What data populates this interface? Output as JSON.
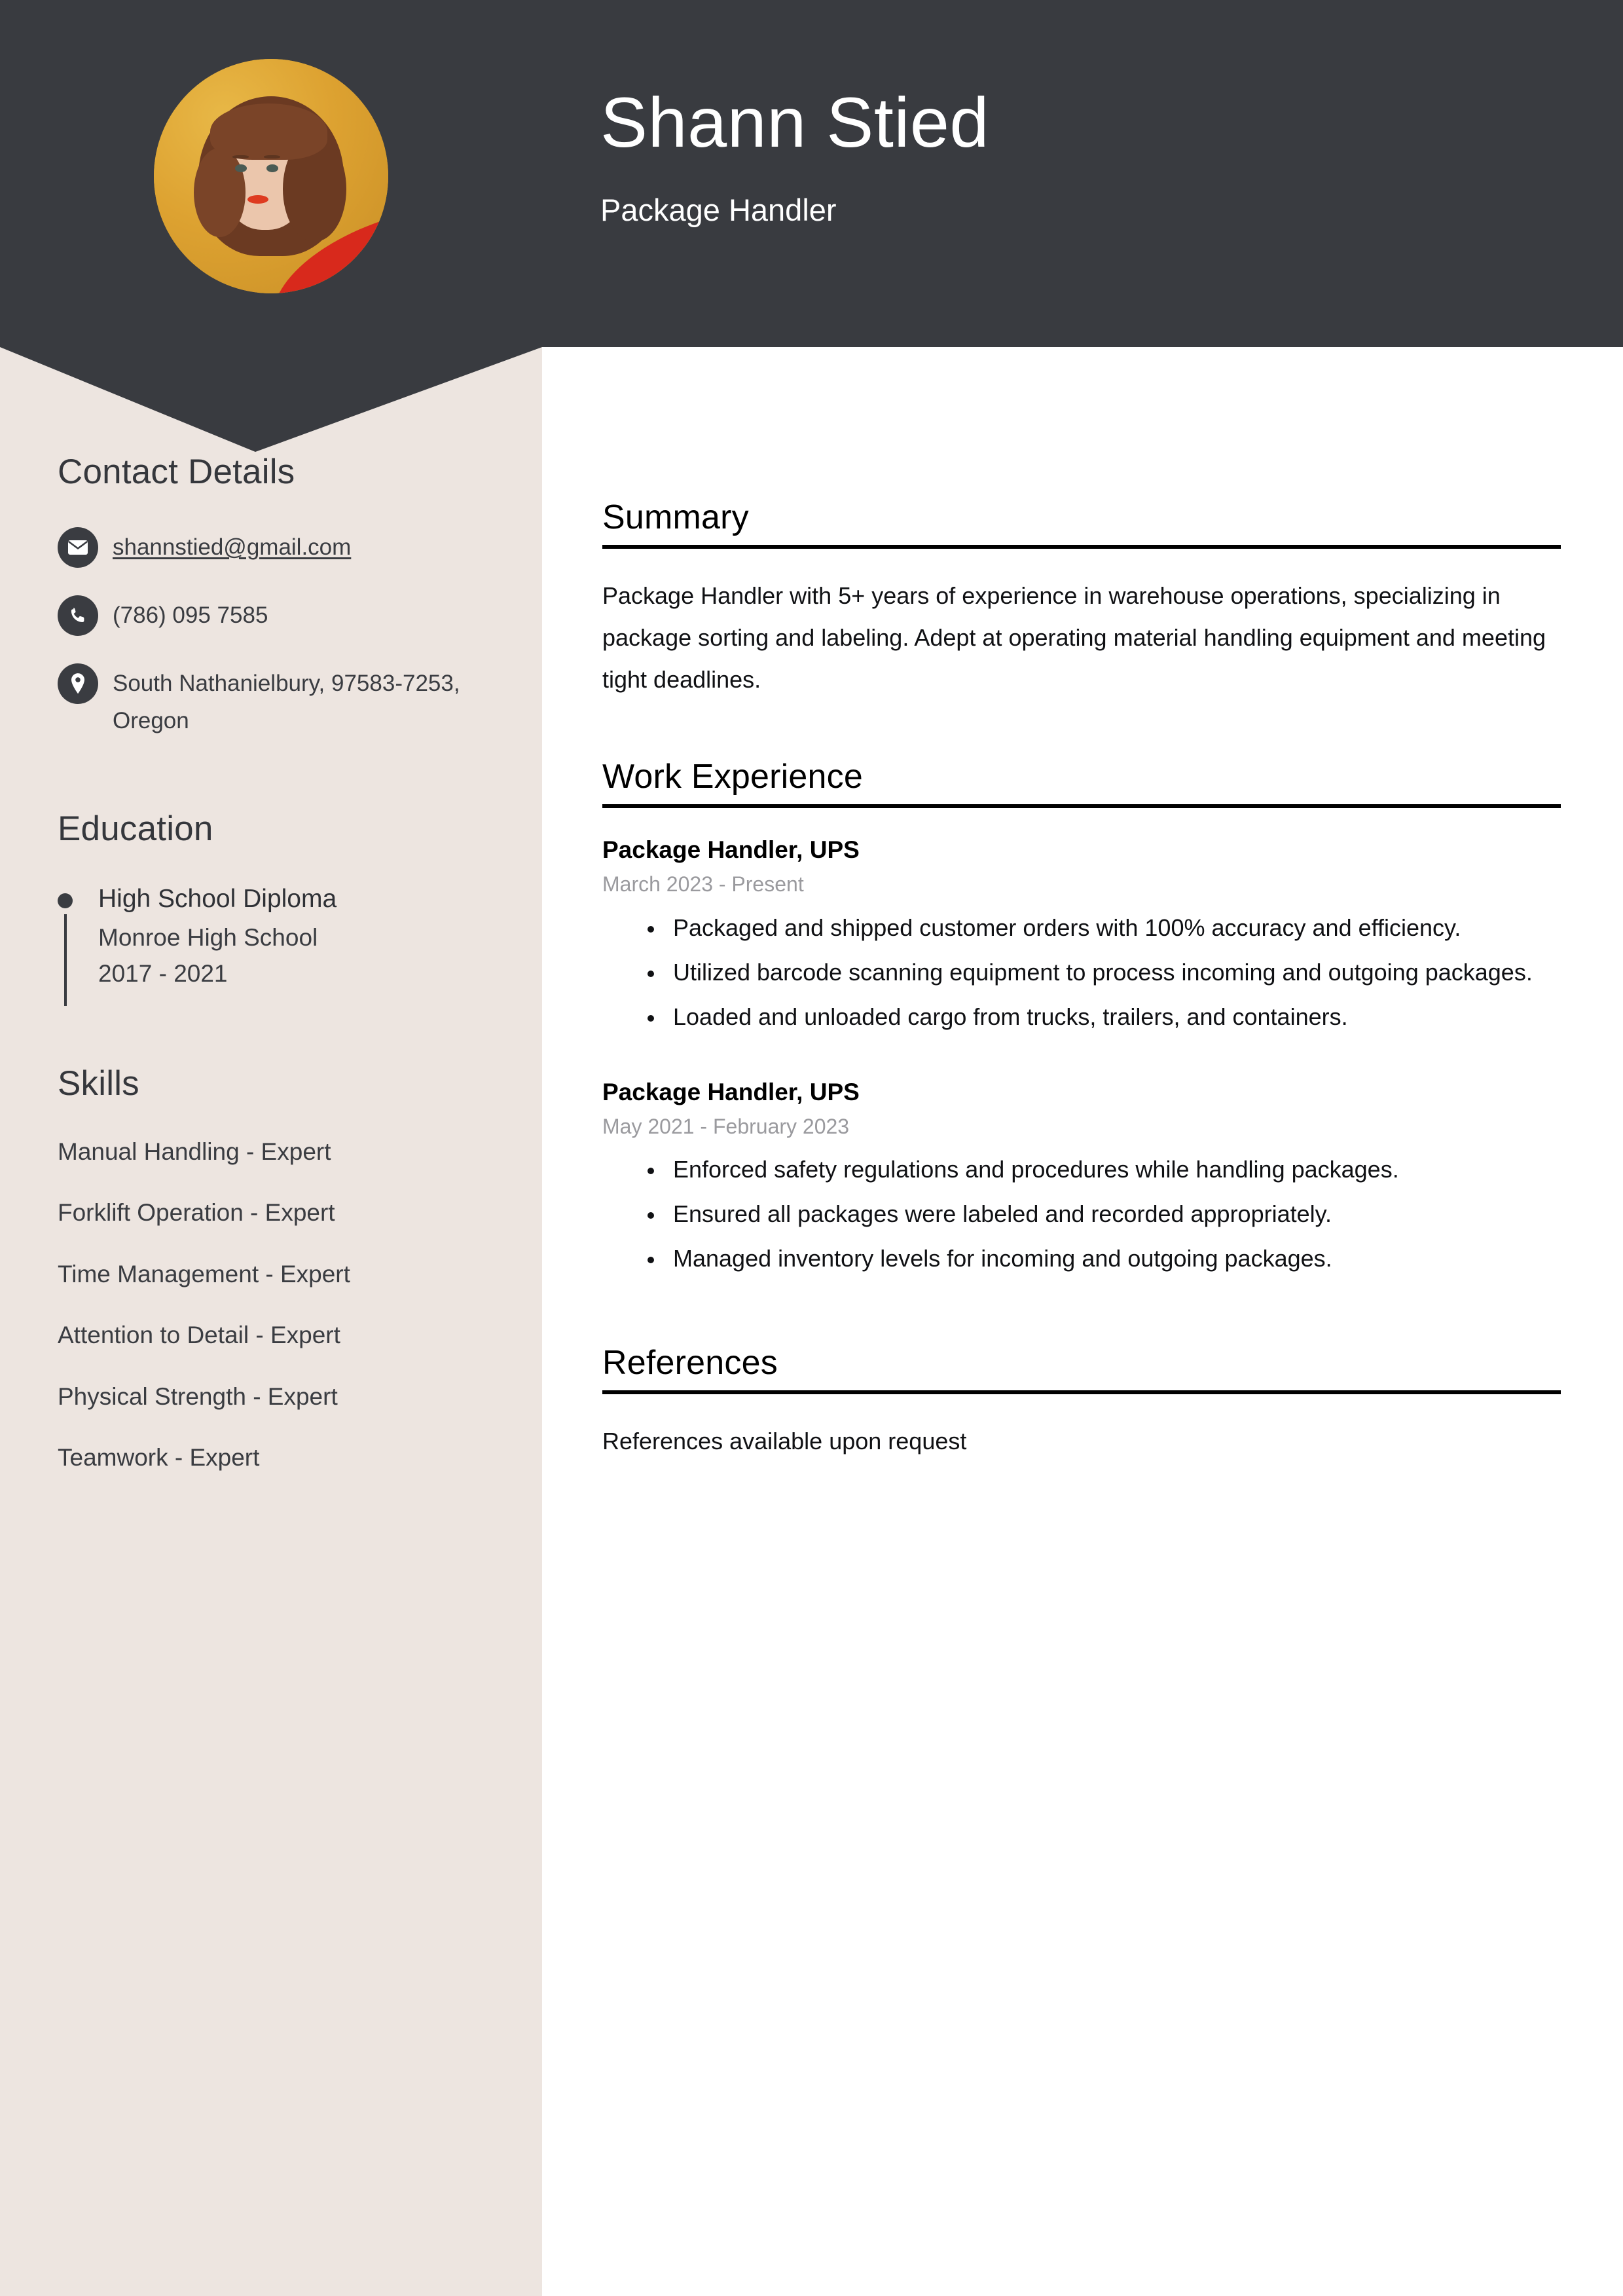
{
  "colors": {
    "header_bg": "#393B40",
    "sidebar_bg": "#EDE5E0",
    "accent_dark": "#3A3C41",
    "photo_bg": "#E0A72E",
    "muted_text": "#9A9A9E",
    "rule": "#000000"
  },
  "header": {
    "name": "Shann Stied",
    "role": "Package Handler",
    "avatar_alt": "profile-photo"
  },
  "sidebar": {
    "contact": {
      "heading": "Contact Details",
      "items": [
        {
          "icon": "envelope-icon",
          "value": "shannstied@gmail.com",
          "is_link": true
        },
        {
          "icon": "phone-icon",
          "value": "(786) 095 7585",
          "is_link": false
        },
        {
          "icon": "location-pin-icon",
          "value": "South Nathanielbury, 97583-7253, Oregon",
          "is_link": false
        }
      ]
    },
    "education": {
      "heading": "Education",
      "items": [
        {
          "degree": "High School Diploma",
          "school": "Monroe High School",
          "dates": "2017 - 2021"
        }
      ]
    },
    "skills": {
      "heading": "Skills",
      "items": [
        "Manual Handling - Expert",
        "Forklift Operation - Expert",
        "Time Management - Expert",
        "Attention to Detail - Expert",
        "Physical Strength - Expert",
        "Teamwork - Expert"
      ]
    }
  },
  "main": {
    "summary": {
      "heading": "Summary",
      "text": "Package Handler with 5+ years of experience in warehouse operations, specializing in package sorting and labeling. Adept at operating material handling equipment and meeting tight deadlines."
    },
    "work_experience": {
      "heading": "Work Experience",
      "jobs": [
        {
          "title": "Package Handler, UPS",
          "dates": "March 2023 - Present",
          "bullets": [
            "Packaged and shipped customer orders with 100% accuracy and efficiency.",
            "Utilized barcode scanning equipment to process incoming and outgoing packages.",
            "Loaded and unloaded cargo from trucks, trailers, and containers."
          ]
        },
        {
          "title": "Package Handler, UPS",
          "dates": "May 2021 - February 2023",
          "bullets": [
            "Enforced safety regulations and procedures while handling packages.",
            "Ensured all packages were labeled and recorded appropriately.",
            "Managed inventory levels for incoming and outgoing packages."
          ]
        }
      ]
    },
    "references": {
      "heading": "References",
      "text": "References available upon request"
    }
  }
}
